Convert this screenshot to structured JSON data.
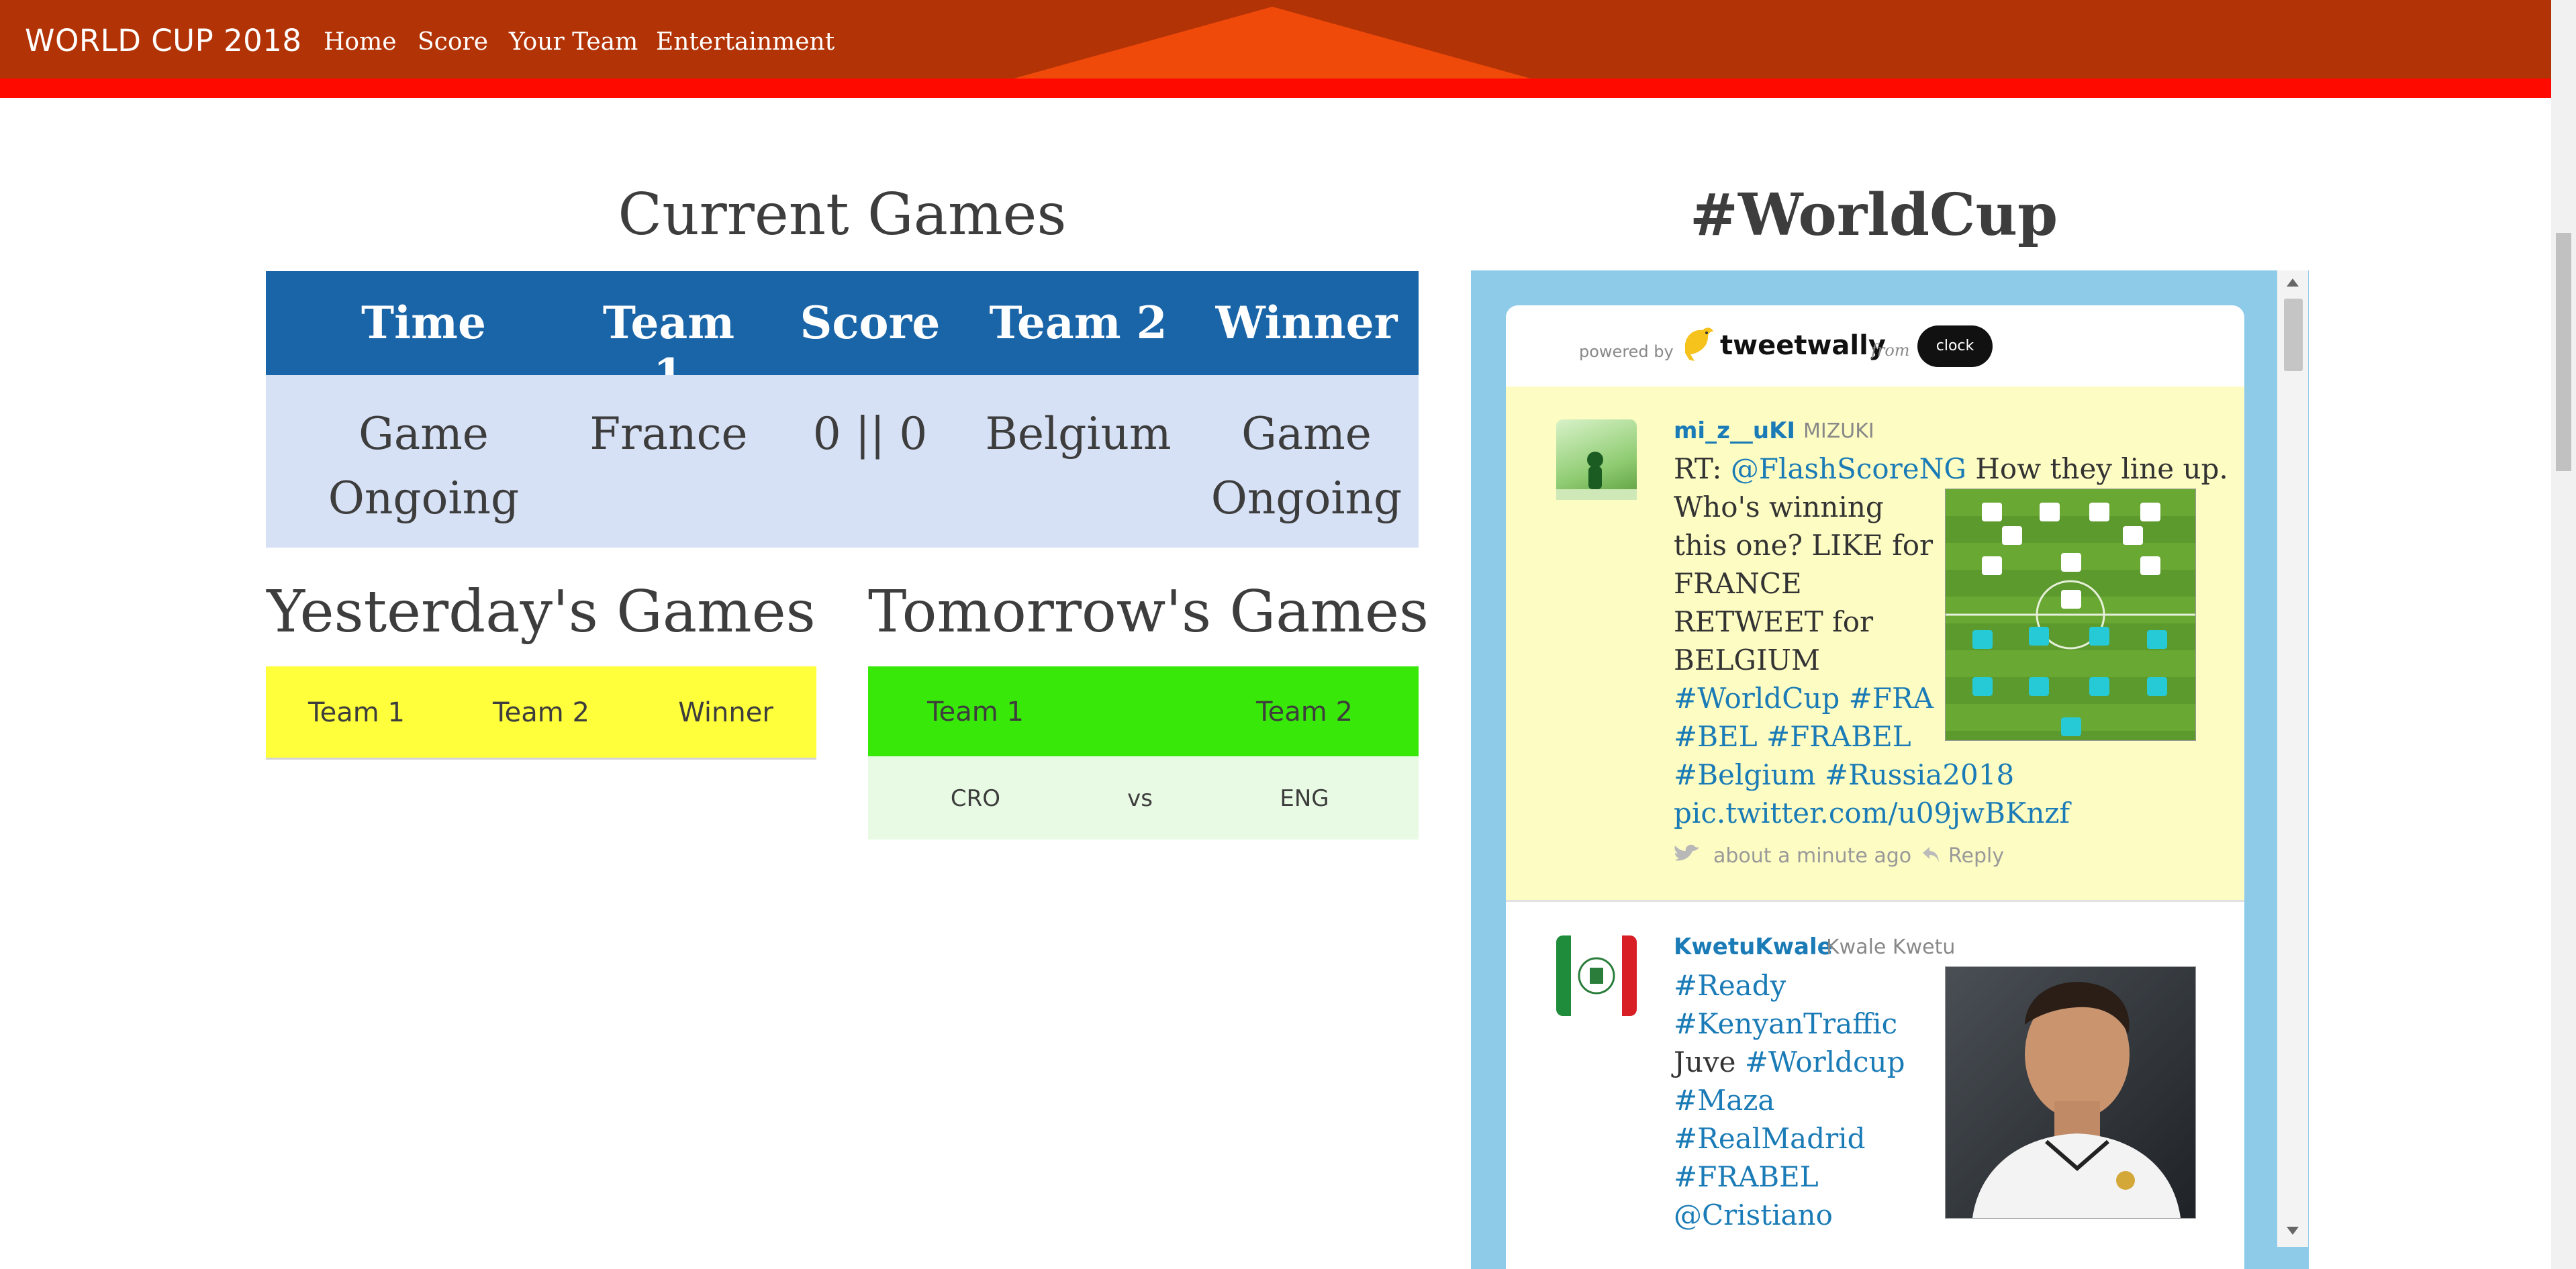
{
  "navbar": {
    "brand": "WORLD CUP 2018",
    "links": [
      "Home",
      "Score",
      "Your Team",
      "Entertainment"
    ]
  },
  "current_games": {
    "title": "Current Games",
    "headers": [
      "Time",
      "Team 1",
      "Score",
      "Team 2",
      "Winner"
    ],
    "row": {
      "time_line1": "Game",
      "time_line2": "Ongoing",
      "team1": "France",
      "score": "0 || 0",
      "team2": "Belgium",
      "winner_line1": "Game",
      "winner_line2": "Ongoing"
    }
  },
  "yesterday": {
    "title": "Yesterday's Games",
    "headers": [
      "Team 1",
      "Team 2",
      "Winner"
    ]
  },
  "tomorrow": {
    "title": "Tomorrow's Games",
    "headers": [
      "Team 1",
      "Team 2"
    ],
    "rows": [
      {
        "team1": "CRO",
        "vs": "vs",
        "team2": "ENG"
      }
    ]
  },
  "twitter": {
    "title": "#WorldCup",
    "powered_by": "powered by",
    "brand": "tweetwally",
    "from": "from",
    "clockwork": "clock work",
    "tweets": [
      {
        "user": "mi_z__uKI",
        "name": "MIZUKI",
        "lines": [
          {
            "pre": "RT: ",
            "link": "@FlashScoreNG",
            "post": " How they line up."
          },
          {
            "pre": "Who's winning",
            "link": "",
            "post": ""
          },
          {
            "pre": "this one? LIKE for",
            "link": "",
            "post": ""
          },
          {
            "pre": "FRANCE",
            "link": "",
            "post": ""
          },
          {
            "pre": "RETWEET for",
            "link": "",
            "post": ""
          },
          {
            "pre": "BELGIUM",
            "link": "",
            "post": ""
          },
          {
            "pre": "",
            "link": "#WorldCup #FRA",
            "post": ""
          },
          {
            "pre": "",
            "link": "#BEL #FRABEL",
            "post": ""
          },
          {
            "pre": "",
            "link": "#Belgium #Russia2018",
            "post": ""
          },
          {
            "pre": "",
            "link": "pic.twitter.com/u09jwBKnzf",
            "post": ""
          }
        ],
        "time": "about a minute ago",
        "reply": "Reply"
      },
      {
        "user": "KwetuKwale",
        "name": "Kwale Kwetu",
        "lines": [
          {
            "pre": "",
            "link": "#Ready",
            "post": ""
          },
          {
            "pre": "",
            "link": "#KenyanTraffic",
            "post": ""
          },
          {
            "pre": "Juve ",
            "link": "#Worldcup",
            "post": ""
          },
          {
            "pre": "",
            "link": "#Maza",
            "post": ""
          },
          {
            "pre": "",
            "link": "#RealMadrid",
            "post": ""
          },
          {
            "pre": "",
            "link": "#FRABEL",
            "post": ""
          },
          {
            "pre": "",
            "link": "@Cristiano",
            "post": ""
          }
        ]
      }
    ]
  },
  "colors": {
    "navbar": "#b23306",
    "nav_accent": "#f04a0a",
    "nav_underline": "#ff0a00",
    "current_header": "#1a65a8",
    "current_body": "#d7e1f5",
    "yesterday_header": "#ffff3b",
    "tomorrow_header": "#38e808",
    "tomorrow_row": "#e8fae3",
    "twitter_frame": "#8dcbe8",
    "tweet_highlight": "#fdfcc3",
    "link": "#1a7bb6"
  }
}
